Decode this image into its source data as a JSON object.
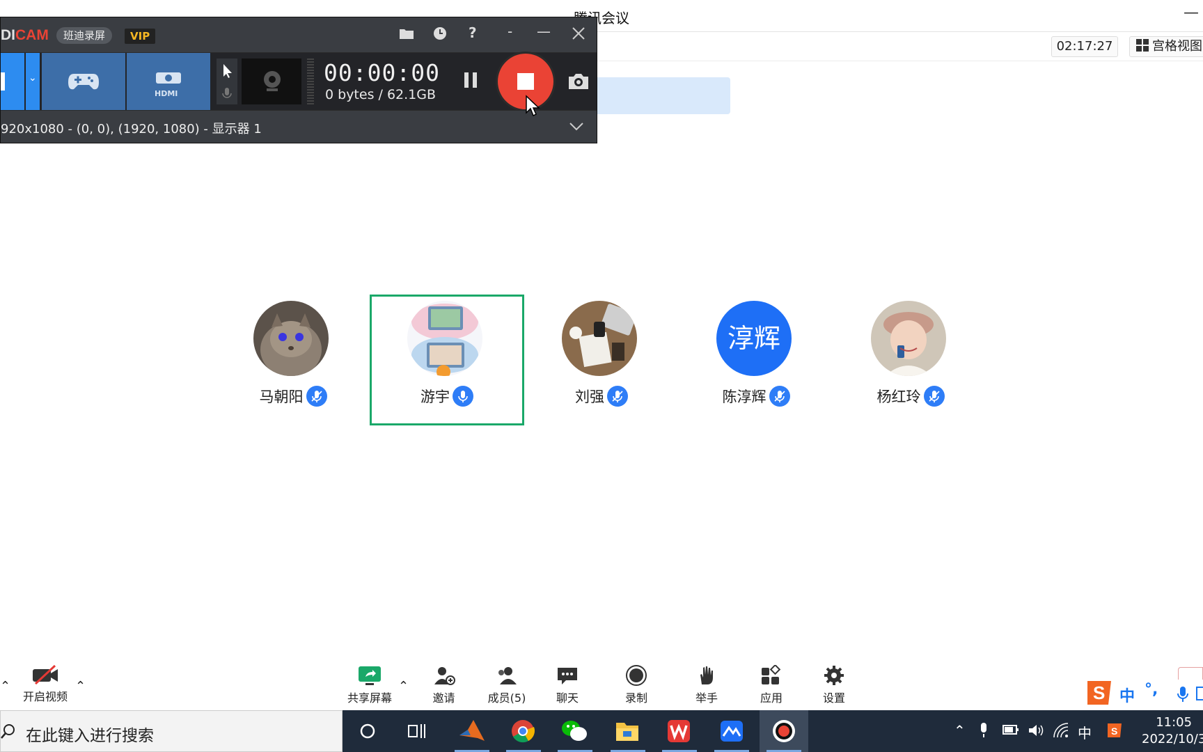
{
  "meeting": {
    "title": "腾讯会议",
    "minimize": "—",
    "timer": "02:17:27",
    "view_label": "宫格视图"
  },
  "participants": [
    {
      "name": "马朝阳",
      "avatar": "cat-photo",
      "speaking": false,
      "mic": "muted"
    },
    {
      "name": "游宇",
      "avatar": "family-photo",
      "speaking": true,
      "mic": "on"
    },
    {
      "name": "刘强",
      "avatar": "desk-photo",
      "speaking": false,
      "mic": "muted"
    },
    {
      "name": "陈淳辉",
      "avatar_text": "淳辉",
      "speaking": false,
      "mic": "muted"
    },
    {
      "name": "杨红玲",
      "avatar": "woman-photo",
      "speaking": false,
      "mic": "muted"
    }
  ],
  "controls": {
    "video": "开启视频",
    "share": "共享屏幕",
    "invite": "邀请",
    "members": "成员(5)",
    "chat": "聊天",
    "record": "录制",
    "raise_hand": "举手",
    "apps": "应用",
    "settings": "设置"
  },
  "bandicam": {
    "logo_prefix": "DI",
    "logo_suffix": "CAM",
    "brand": "班迪录屏",
    "vip": "VIP",
    "mode_hdmi": "HDMI",
    "record_time": "00:00:00",
    "size": "0 bytes / 62.1GB",
    "status": "920x1080 - (0, 0), (1920, 1080) - 显示器 1",
    "title_icons": [
      "folder-icon",
      "clock-icon",
      "help-icon",
      "minimize-icon",
      "close-icon"
    ]
  },
  "taskbar": {
    "search_placeholder": "在此键入进行搜索",
    "apps": [
      "cortana-icon",
      "task-view-icon",
      "matlab-icon",
      "chrome-icon",
      "wechat-icon",
      "file-explorer-icon",
      "wps-icon",
      "tencent-meeting-icon",
      "bandicam-icon"
    ],
    "ime_lang": "中",
    "clock_time": "11:05",
    "clock_date": "2022/10/3"
  },
  "ime": {
    "lang": "中",
    "punct": "°,"
  },
  "colors": {
    "accent_blue": "#2e7df7",
    "speaking_border": "#1aa869",
    "record_red": "#ea4335",
    "bandicam_mode": "#3d6ea8"
  }
}
